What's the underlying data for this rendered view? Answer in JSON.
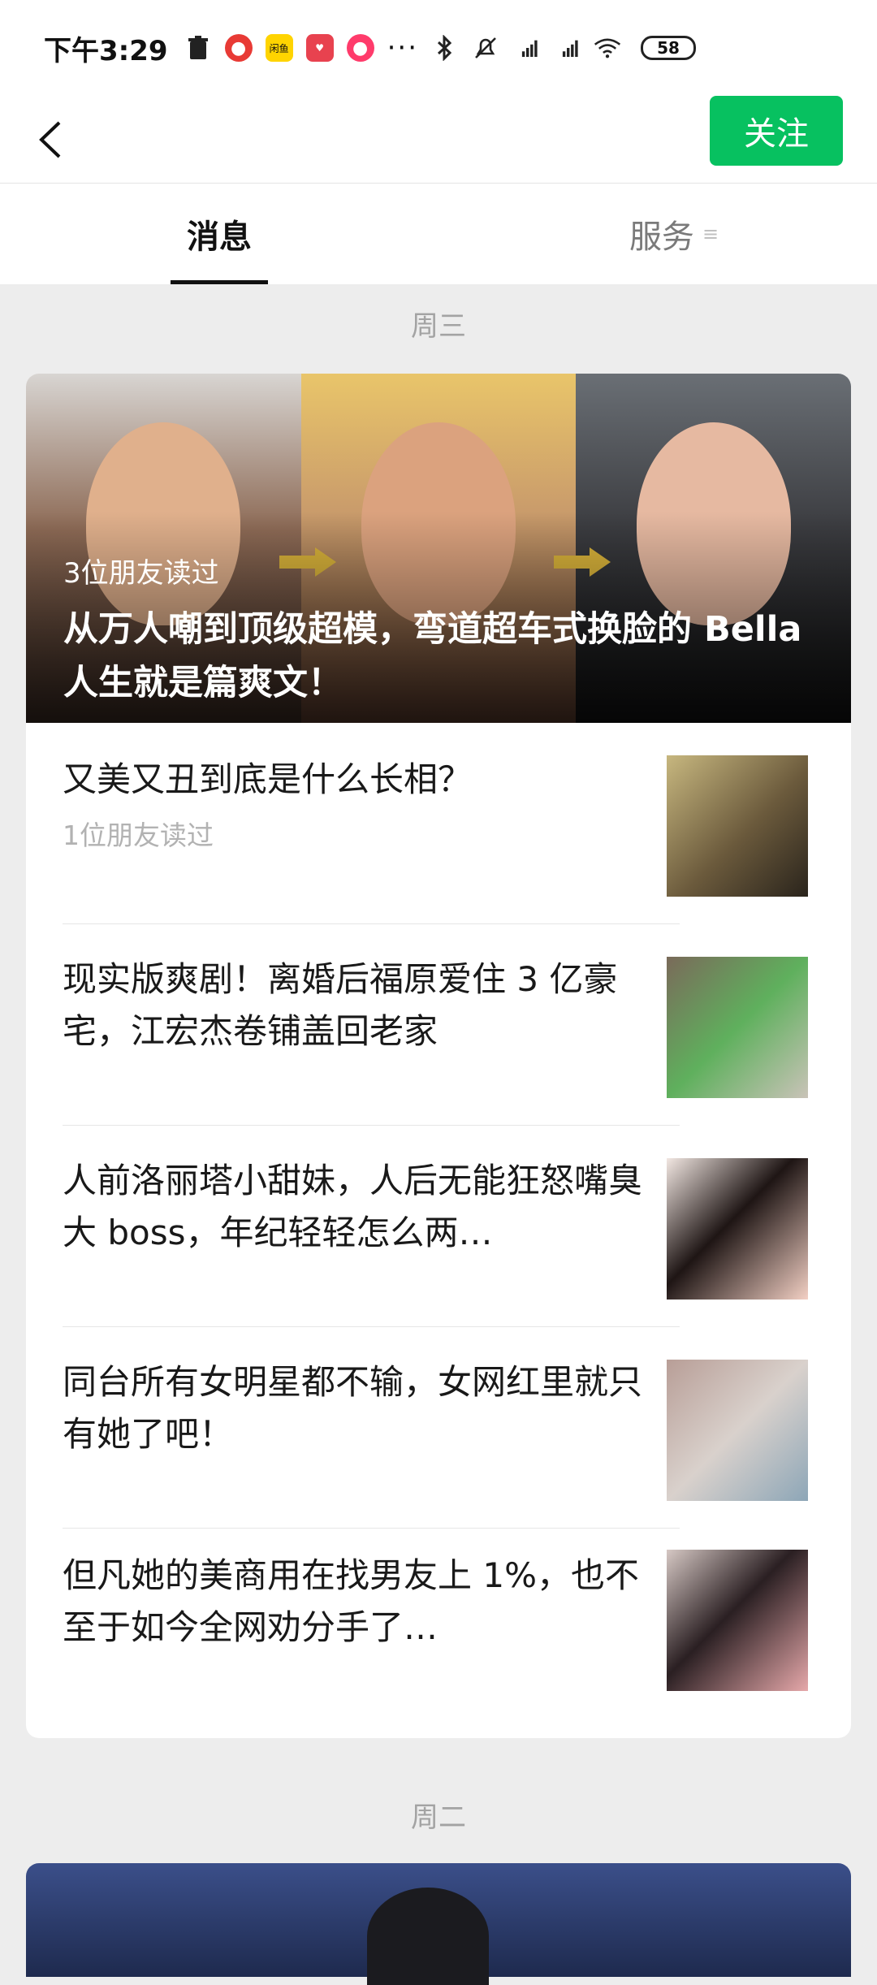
{
  "status_bar": {
    "time": "下午3:29",
    "battery": "58",
    "app_badges": [
      "",
      "闲鱼",
      "",
      ""
    ]
  },
  "nav": {
    "follow_label": "关注"
  },
  "tabs": {
    "messages": "消息",
    "services": "服务"
  },
  "date_groups": {
    "first": "周三",
    "second": "周二"
  },
  "hero": {
    "readers": "3位朋友读过",
    "title": "从万人嘲到顶级超模，弯道超车式换脸的 Bella 人生就是篇爽文！"
  },
  "articles": [
    {
      "title": "又美又丑到底是什么长相？",
      "meta": "1位朋友读过"
    },
    {
      "title": "现实版爽剧！离婚后福原爱住 3 亿豪宅，江宏杰卷铺盖回老家",
      "meta": ""
    },
    {
      "title": "人前洛丽塔小甜妹，人后无能狂怒嘴臭大 boss，年纪轻轻怎么两…",
      "meta": ""
    },
    {
      "title": "同台所有女明星都不输，女网红里就只有她了吧！",
      "meta": ""
    },
    {
      "title": "但凡她的美商用在找男友上 1%，也不至于如今全网劝分手了…",
      "meta": ""
    }
  ],
  "colors": {
    "accent": "#07c160",
    "background": "#ededed"
  }
}
